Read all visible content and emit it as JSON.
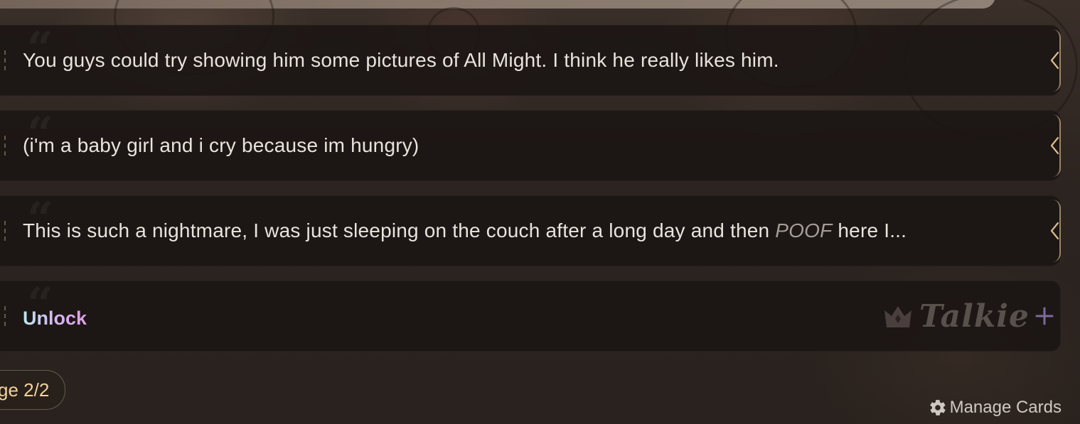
{
  "cards": [
    {
      "text_before": "You guys could try showing him some pictures of All Might. I think he really likes him.",
      "emphasis": "",
      "text_after": ""
    },
    {
      "text_before": "(i'm a baby girl and i cry because im hungry)",
      "emphasis": "",
      "text_after": ""
    },
    {
      "text_before": "This is such a nightmare, I was just sleeping on the couch after a long day and then ",
      "emphasis": "POOF",
      "text_after": " here I..."
    }
  ],
  "locked_card": {
    "label": "Unlock",
    "brand": "Talkie"
  },
  "pagination": {
    "label": "ge 2/2"
  },
  "manage": {
    "label": "Manage Cards"
  },
  "colors": {
    "page_label": "#f1d39a",
    "card_bg": "#1a1513",
    "accent_edge": "#dcbe8c",
    "unlock_gradient_start": "#b8e6f2",
    "unlock_gradient_end": "#e0a0e8"
  },
  "icons": {
    "expand": "chevron-left-icon",
    "manage": "gear-icon",
    "premium": "crown-icon",
    "plus": "sparkle-plus-icon"
  }
}
